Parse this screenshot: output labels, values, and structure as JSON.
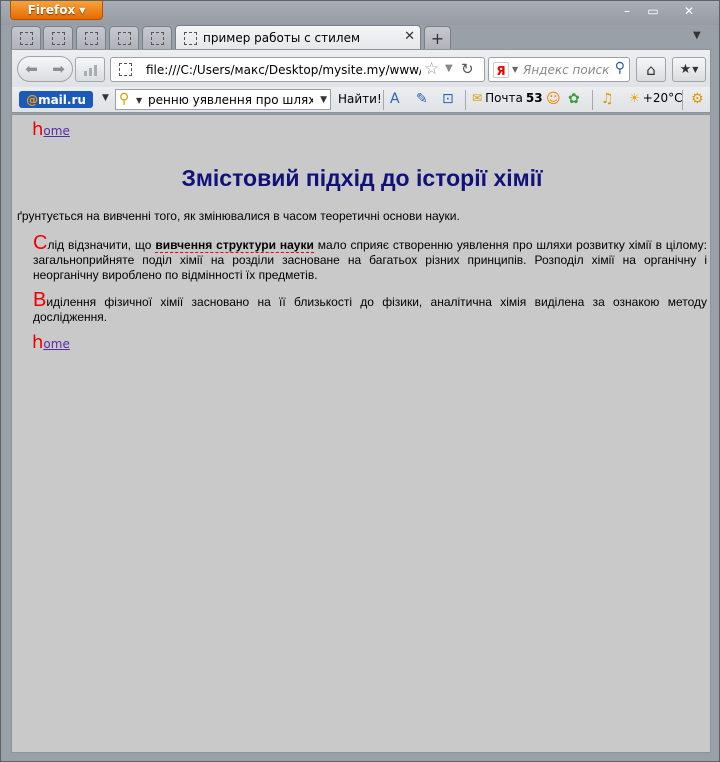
{
  "browser": {
    "menu_button": "Firefox",
    "window_controls": {
      "minimize": "–",
      "maximize": "▭",
      "close": "✕"
    }
  },
  "tabs": [
    {
      "label": "",
      "active": false
    },
    {
      "label": "",
      "active": false
    },
    {
      "label": "",
      "active": false
    },
    {
      "label": "",
      "active": false
    },
    {
      "label": "",
      "active": false
    },
    {
      "label": "пример работы с стилем",
      "active": true
    }
  ],
  "new_tab_label": "+",
  "address_bar": {
    "url": "file:///C:/Users/макс/Desktop/mysite.my/www/files"
  },
  "search_bar": {
    "engine": "Я",
    "placeholder": "Яндекс поиск"
  },
  "mailru_toolbar": {
    "logo_prefix": "@",
    "logo_text": "mail.ru",
    "search_value": "ренню уявлення про шляхи р",
    "search_button": "Найти!",
    "mail_label": "Почта",
    "mail_count": "53",
    "weather": "+20°C"
  },
  "page": {
    "home_link_initial": "h",
    "home_link_rest": "ome",
    "title": "Змістовий підхід до історії хімії",
    "intro": "ґрунтується на вивченні того, як змінювалися в часом теоретичні основи науки.",
    "para1": {
      "drop": "С",
      "before": "лід відзначити, що ",
      "strong": "вивчення структури науки",
      "after": " мало сприяє створенню уявлення про шляхи розвитку хімії в цілому: загальноприйняте поділ хімії на розділи засноване на багатьох різних принципів. Розподіл хімії на органічну і неорганічну вироблено по відмінності їх предметів."
    },
    "para2": {
      "drop": "В",
      "rest": "иділення фізичної хімії засновано на її близькості до фізики, аналітична хімія виділена за ознакою методу дослідження."
    }
  }
}
